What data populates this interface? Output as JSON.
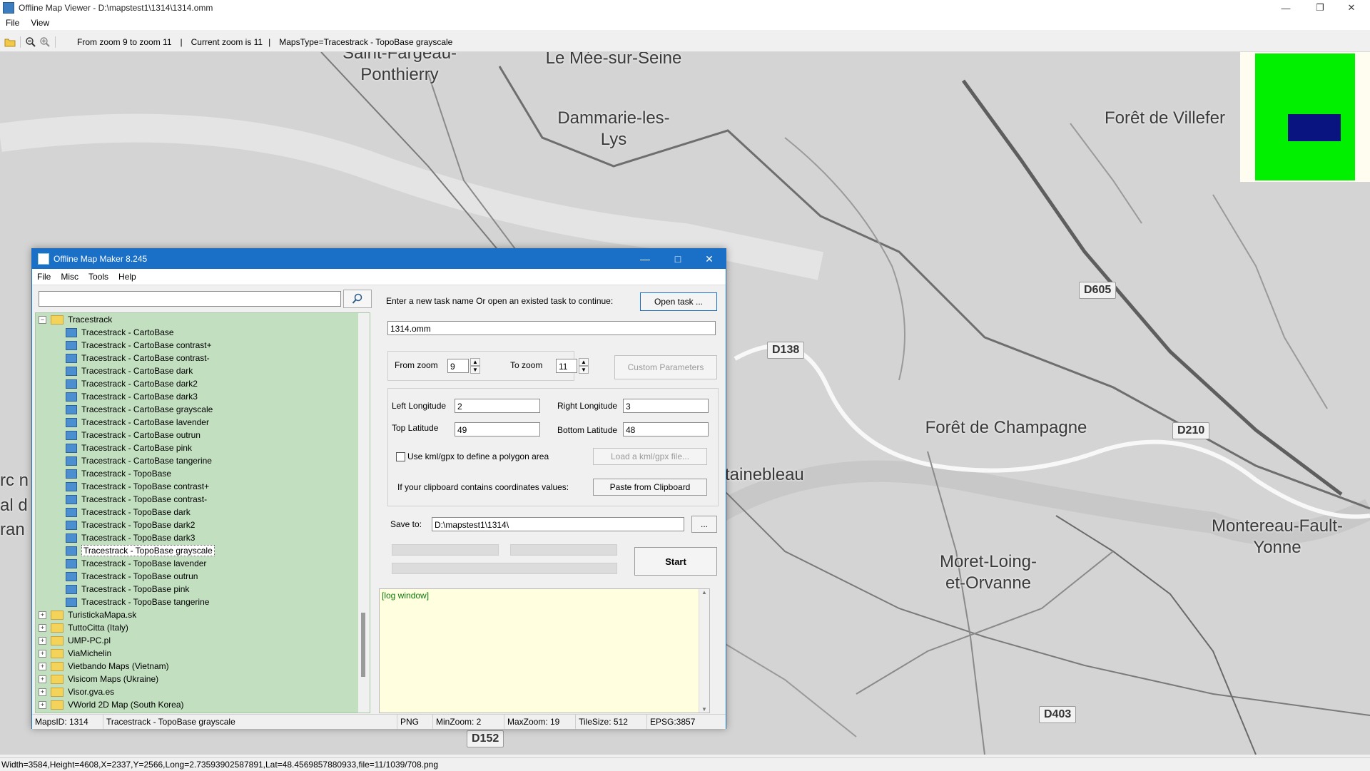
{
  "window": {
    "title": "Offline Map Viewer - D:\\mapstest1\\1314\\1314.omm",
    "controls": {
      "minimize": "—",
      "restore": "❐",
      "close": "✕"
    }
  },
  "menu": [
    "File",
    "View"
  ],
  "toolbar": {
    "icons": [
      "open-folder-icon",
      "zoom-out-icon",
      "zoom-in-icon"
    ],
    "zoom_range": "From zoom 9 to zoom 11",
    "current_zoom": "Current zoom is 11",
    "maps_type": "MapsType=Tracestrack - TopoBase grayscale",
    "separator": "|"
  },
  "map": {
    "places": [
      "Saint-Fargeau-\nPonthierry",
      "Le Mée-sur-Seine",
      "Dammarie-les-\nLys",
      "Forêt de Villefer",
      "Forêt de Champagne",
      "tainebleau",
      "Montereau-Fault-\nYonne",
      "Moret-Loing-\net-Orvanne",
      "rc n",
      "al d",
      "ran"
    ],
    "roads": [
      "D605",
      "D138",
      "D210",
      "D403",
      "D152"
    ],
    "colors": {
      "overview_green": "#00f000",
      "overview_blue": "#0a1480"
    }
  },
  "status_main": "Width=3584,Height=4608,X=2337,Y=2566,Long=2.73593902587891,Lat=48.4569857880933,file=11/1039/708.png",
  "dialog": {
    "title": "Offline Map Maker 8.245",
    "menu": [
      "File",
      "Misc",
      "Tools",
      "Help"
    ],
    "search_value": "",
    "tree": {
      "root": "Tracestrack",
      "children": [
        "Tracestrack - CartoBase",
        "Tracestrack - CartoBase contrast+",
        "Tracestrack - CartoBase contrast-",
        "Tracestrack - CartoBase dark",
        "Tracestrack - CartoBase dark2",
        "Tracestrack - CartoBase dark3",
        "Tracestrack - CartoBase grayscale",
        "Tracestrack - CartoBase lavender",
        "Tracestrack - CartoBase outrun",
        "Tracestrack - CartoBase pink",
        "Tracestrack - CartoBase tangerine",
        "Tracestrack - TopoBase",
        "Tracestrack - TopoBase contrast+",
        "Tracestrack - TopoBase contrast-",
        "Tracestrack - TopoBase dark",
        "Tracestrack - TopoBase dark2",
        "Tracestrack - TopoBase dark3",
        "Tracestrack - TopoBase grayscale",
        "Tracestrack - TopoBase lavender",
        "Tracestrack - TopoBase outrun",
        "Tracestrack - TopoBase pink",
        "Tracestrack - TopoBase tangerine"
      ],
      "selected": "Tracestrack - TopoBase grayscale",
      "folders": [
        "TuristickaMapa.sk",
        "TuttoCitta (Italy)",
        "UMP-PC.pl",
        "ViaMichelin",
        "Vietbando Maps (Vietnam)",
        "Visicom Maps (Ukraine)",
        "Visor.gva.es",
        "VWorld 2D Map (South Korea)"
      ]
    },
    "task_prompt": "Enter a new task name Or open an existed task to continue:",
    "open_task": "Open task ...",
    "task_name": "1314.omm",
    "from_zoom_label": "From zoom",
    "from_zoom": "9",
    "to_zoom_label": "To zoom",
    "to_zoom": "11",
    "custom_params": "Custom Parameters",
    "left_lon_label": "Left Longitude",
    "left_lon": "2",
    "right_lon_label": "Right Longitude",
    "right_lon": "3",
    "top_lat_label": "Top Latitude",
    "top_lat": "49",
    "bottom_lat_label": "Bottom Latitude",
    "bottom_lat": "48",
    "use_kml": "Use kml/gpx to define a polygon area",
    "load_kml": "Load a kml/gpx file...",
    "clipboard_label": "If your clipboard contains coordinates values:",
    "paste_clipboard": "Paste from Clipboard",
    "save_to_label": "Save to:",
    "save_to": "D:\\mapstest1\\1314\\",
    "browse": "...",
    "start": "Start",
    "progress": [
      0,
      0,
      0
    ],
    "log": "[log window]",
    "status": {
      "maps_id": "MapsID: 1314",
      "map_name": "Tracestrack - TopoBase grayscale",
      "format": "PNG",
      "min_zoom": "MinZoom: 2",
      "max_zoom": "MaxZoom: 19",
      "tile_size": "TileSize: 512",
      "epsg": "EPSG:3857"
    }
  }
}
